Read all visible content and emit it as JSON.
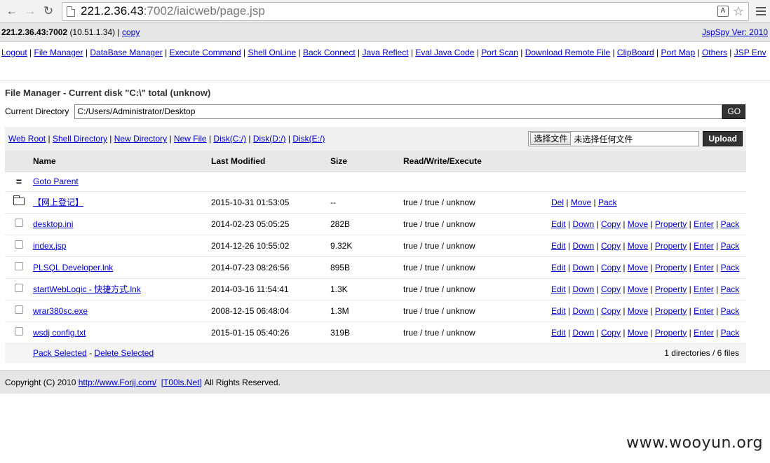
{
  "browser": {
    "url_host": "221.2.36.43",
    "url_path": ":7002/iaicweb/page.jsp"
  },
  "topbar": {
    "host": "221.2.36.43:7002",
    "ip": "(10.51.1.34)",
    "sep": "|",
    "copy": "copy",
    "version": "JspSpy Ver: 2010"
  },
  "nav": [
    "Logout",
    "File Manager",
    "DataBase Manager",
    "Execute Command",
    "Shell OnLine",
    "Back Connect",
    "Java Reflect",
    "Eval Java Code",
    "Port Scan",
    "Download Remote File",
    "ClipBoard",
    "Port Map",
    "Others",
    "JSP Env"
  ],
  "fm": {
    "title": "File Manager - Current disk \"C:\\\" total (unknow)",
    "curdir_label": "Current Directory",
    "curdir_value": "C:/Users/Administrator/Desktop",
    "go": "GO"
  },
  "disks": [
    "Web Root",
    "Shell Directory",
    "New Directory",
    "New File",
    "Disk(C:/)",
    "Disk(D:/)",
    "Disk(E:/)"
  ],
  "upload": {
    "choose": "选择文件",
    "none": "未选择任何文件",
    "button": "Upload"
  },
  "table": {
    "headers": [
      "Name",
      "Last Modified",
      "Size",
      "Read/Write/Execute"
    ],
    "parent_icon": "=",
    "parent": "Goto Parent",
    "folder": {
      "name": "【网上登记】",
      "modified": "2015-10-31 01:53:05",
      "size": "--",
      "rwx": "true / true / unknow",
      "actions": [
        "Del",
        "Move",
        "Pack"
      ]
    },
    "file_actions": [
      "Edit",
      "Down",
      "Copy",
      "Move",
      "Property",
      "Enter",
      "Pack"
    ],
    "files": [
      {
        "name": "desktop.ini",
        "modified": "2014-02-23 05:05:25",
        "size": "282B",
        "rwx": "true / true / unknow"
      },
      {
        "name": "index.jsp",
        "modified": "2014-12-26 10:55:02",
        "size": "9.32K",
        "rwx": "true / true / unknow"
      },
      {
        "name": "PLSQL Developer.lnk",
        "modified": "2014-07-23 08:26:56",
        "size": "895B",
        "rwx": "true / true / unknow"
      },
      {
        "name": "startWebLogic - 快捷方式.lnk",
        "modified": "2014-03-16 11:54:41",
        "size": "1.3K",
        "rwx": "true / true / unknow"
      },
      {
        "name": "wrar380sc.exe",
        "modified": "2008-12-15 06:48:04",
        "size": "1.3M",
        "rwx": "true / true / unknow"
      },
      {
        "name": "wsdj config.txt",
        "modified": "2015-01-15 05:40:26",
        "size": "319B",
        "rwx": "true / true / unknow"
      }
    ],
    "pack_selected": "Pack Selected",
    "dash": "-",
    "delete_selected": "Delete Selected",
    "count": "1 directories / 6 files"
  },
  "footer": {
    "copyright": "Copyright (C) 2010",
    "link1": "http://www.Forjj.com/",
    "link2": "[T00ls.Net]",
    "rights": "All Rights Reserved."
  },
  "watermark": "www.wooyun.org"
}
